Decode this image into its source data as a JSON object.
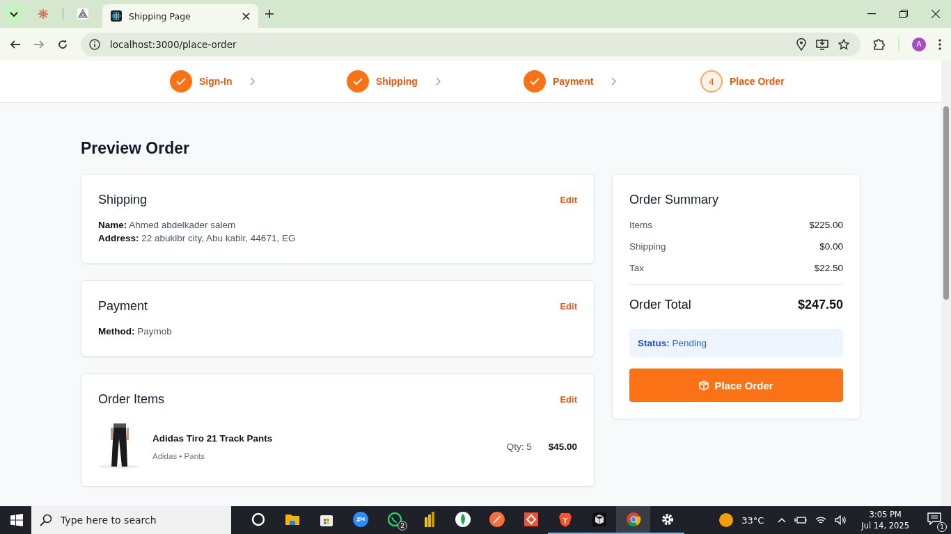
{
  "browser": {
    "tabs": [
      {
        "kind": "claude",
        "selected": false
      },
      {
        "kind": "triangle",
        "selected": false
      },
      {
        "kind": "react",
        "title": "Shipping Page",
        "selected": true
      }
    ],
    "url": "localhost:3000/place-order",
    "profile_initial": "A"
  },
  "steps": [
    {
      "label": "Sign-In",
      "done": true
    },
    {
      "label": "Shipping",
      "done": true
    },
    {
      "label": "Payment",
      "done": true
    },
    {
      "label": "Place Order",
      "number": "4",
      "done": false
    }
  ],
  "page_title": "Preview Order",
  "sections": [
    {
      "title": "Shipping",
      "edit": "Edit",
      "lines": [
        "**Name:** Ahmed abdelkader salem",
        "**Address:** 22 abukibr city, Abu kabir, 44671, EG"
      ]
    },
    {
      "title": "Payment",
      "edit": "Edit",
      "lines": [
        "**Method:** Paymob"
      ]
    }
  ],
  "order_items": {
    "title": "Order Items",
    "edit": "Edit",
    "items": [
      {
        "name": "Adidas Tiro 21 Track Pants",
        "meta": "Adidas • Pants",
        "qty": "Qty: 5",
        "price": "$45.00"
      }
    ]
  },
  "summary": {
    "title": "Order Summary",
    "rows": [
      {
        "label": "Items",
        "value": "$225.00"
      },
      {
        "label": "Shipping",
        "value": "$0.00"
      },
      {
        "label": "Tax",
        "value": "$22.50"
      }
    ],
    "total": {
      "label": "Order Total",
      "value": "$247.50"
    },
    "status": "**Status:** Pending",
    "button": "Place Order"
  },
  "taskbar": {
    "search_placeholder": "Type here to search",
    "apps": [
      {
        "kind": "cortana",
        "running": false
      },
      {
        "kind": "folder",
        "running": false
      },
      {
        "kind": "store",
        "running": false
      },
      {
        "kind": "zoom",
        "running": false
      },
      {
        "kind": "whatsapp",
        "running": false,
        "badge": "2"
      },
      {
        "kind": "powerbi",
        "running": false
      },
      {
        "kind": "leaf",
        "running": false
      },
      {
        "kind": "postman",
        "running": false
      },
      {
        "kind": "git",
        "running": false
      },
      {
        "kind": "brave",
        "running": true
      },
      {
        "kind": "cube",
        "running": true
      },
      {
        "kind": "chrome",
        "running": true,
        "selected": true
      },
      {
        "kind": "gear",
        "running": true
      }
    ],
    "temperature": "33°C",
    "time": "3:05 PM",
    "date": "Jul 14, 2025",
    "notifications": "1"
  }
}
